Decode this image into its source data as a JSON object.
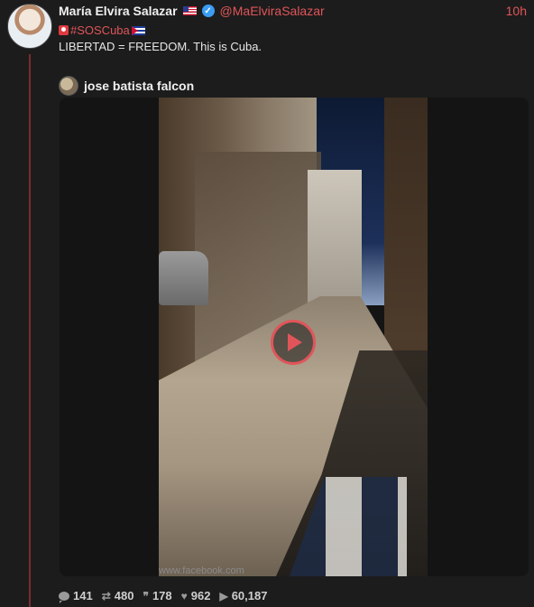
{
  "author": {
    "name": "María Elvira Salazar",
    "handle": "@MaElviraSalazar",
    "time": "10h"
  },
  "tweet": {
    "hashtag": "#SOSCuba",
    "text": "LIBERTAD = FREEDOM. This is Cuba."
  },
  "quote": {
    "name": "jose batista falcon"
  },
  "media": {
    "watermark": "www.facebook.com",
    "play_icon": "play-icon"
  },
  "stats": {
    "replies": "141",
    "retweets": "480",
    "quotes": "178",
    "likes": "962",
    "views": "60,187"
  },
  "colors": {
    "accent": "#e0555a",
    "background": "#1c1c1c",
    "thread_line": "#7a2c30"
  }
}
